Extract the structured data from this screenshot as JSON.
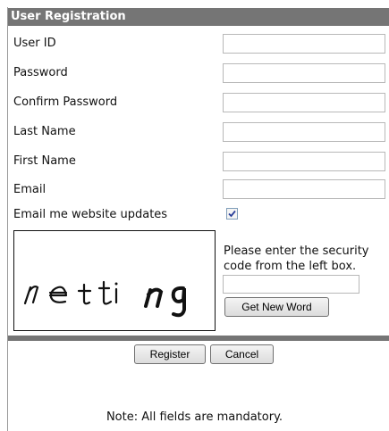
{
  "form": {
    "title": "User Registration",
    "fields": [
      {
        "label": "User ID",
        "value": ""
      },
      {
        "label": "Password",
        "value": ""
      },
      {
        "label": "Confirm Password",
        "value": ""
      },
      {
        "label": "Last Name",
        "value": ""
      },
      {
        "label": "First Name",
        "value": ""
      },
      {
        "label": "Email",
        "value": ""
      }
    ],
    "updates_label": "Email me website updates",
    "updates_checked": true
  },
  "captcha": {
    "word": "netting",
    "instructions": "Please enter the security code from the left box.",
    "new_word_label": "Get New Word"
  },
  "actions": {
    "register_label": "Register",
    "cancel_label": "Cancel"
  },
  "footer": {
    "note": "Note: All fields are mandatory."
  }
}
